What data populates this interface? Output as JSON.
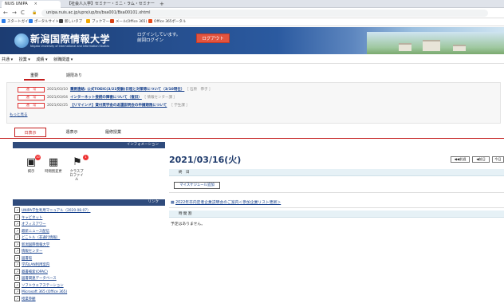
{
  "browser": {
    "tabs": [
      {
        "label": "NUIS UNIPA",
        "active": true
      },
      {
        "label": "【社会人入学】セミナー・ミニ・ラム・セミナー",
        "active": false
      }
    ],
    "new_tab": "+",
    "nav": {
      "back": "←",
      "forward": "→",
      "reload": "C"
    },
    "url": "unipa.nuis.ac.jp/uprx/up/bs/bsa001/Bsa00101.xhtml",
    "bookmarks": [
      {
        "label": "スタートガイド",
        "color": "#2b7de9"
      },
      {
        "label": "ポータルサイト",
        "color": "#2b7de9"
      },
      {
        "label": "新しいタブ",
        "color": "#444"
      },
      {
        "label": "ブックマーク",
        "color": "#f2a900"
      },
      {
        "label": "メール(Office 365)",
        "color": "#d84315"
      },
      {
        "label": "Office 365ポータル",
        "color": "#e64a19"
      }
    ]
  },
  "header": {
    "university": "新潟国際情報大学",
    "university_en": "Niigata University of International and Information Studies",
    "login_line1": "ログインしています。",
    "login_line2": "前回ログイン",
    "logout": "ログアウト"
  },
  "menu": [
    "共通 ▾",
    "授業 ▾",
    "成績 ▾",
    "就職関連 ▾"
  ],
  "notice_tabs": [
    "重要",
    "期限あり"
  ],
  "notices": [
    {
      "badge": "通　常",
      "date": "2021/03/10",
      "title": "重要連絡: 公式TOEIC(3/21受験)日程と対策等について（3/10現在）",
      "source": "［ 石原　恭子 ］"
    },
    {
      "badge": "通　常",
      "date": "2021/03/04",
      "title": "インターネット接続の障害について（復旧）",
      "source": "［ 情報センター課 ］"
    },
    {
      "badge": "通　常",
      "date": "2021/02/25",
      "title": "【リマインド】貸付奨学金の返還説明会の申請期限について",
      "source": "［ 学生課 ］"
    }
  ],
  "more": "もっと見る",
  "view_tabs": [
    "日表示",
    "週表示",
    "履修授業"
  ],
  "sidebar": {
    "info_header": "インフォメーション",
    "icons": [
      {
        "label": "掲示",
        "badge": "10",
        "icon": "bulletin-icon"
      },
      {
        "label": "時間割変更",
        "badge": "",
        "icon": "timetable-icon"
      },
      {
        "label": "クラスプロファイル",
        "badge": "1",
        "icon": "class-profile-icon"
      }
    ],
    "link_header": "リンク",
    "links": [
      "UNIPA学生利用マニュアル（2020.08.07）",
      "キャビネット",
      "オフィスアワー",
      "最新ニュース配信",
      "どこトル（非通行情報）",
      "新潟国際情報大学",
      "情報センター",
      "図書館",
      "学内LAN利用案内",
      "蔵書検索(OPAC)",
      "図書関連データベース",
      "ソフトウェアステーション",
      "Microsoft 365 (Office 365)",
      "授業参観"
    ]
  },
  "main": {
    "date": "2021/03/16(火)",
    "nav_buttons": [
      "◀◀前週",
      "◀前日",
      "今日"
    ],
    "section1": "終　日",
    "schedule_button": "マイスケジュール追加",
    "seminar": "2022年卒内定者企業説明会のご案内＜参加企業リスト更新＞",
    "section2": "時 間 割",
    "no_schedule": "予定はありません。"
  }
}
